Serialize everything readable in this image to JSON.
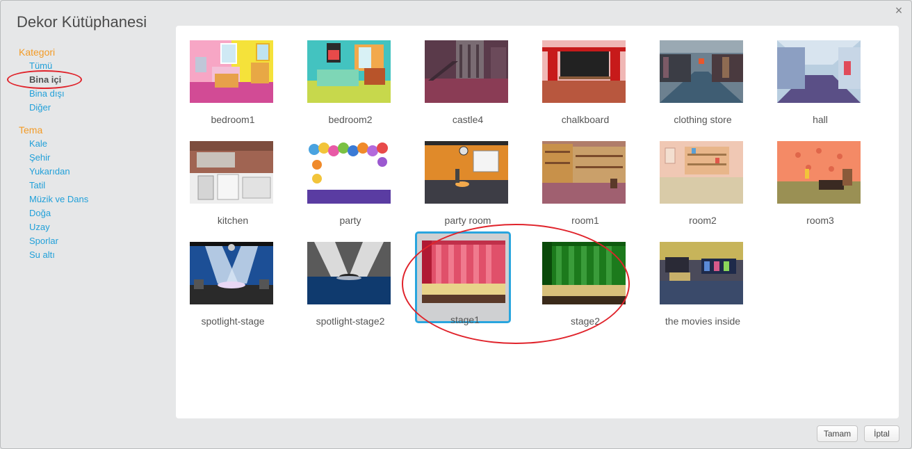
{
  "dialog": {
    "title": "Dekor Kütüphanesi",
    "close_glyph": "×"
  },
  "sidebar": {
    "category_heading": "Kategori",
    "categories": [
      "Tümü",
      "Bina içi",
      "Bina dışı",
      "Diğer"
    ],
    "selected_category": "Bina içi",
    "theme_heading": "Tema",
    "themes": [
      "Kale",
      "Şehir",
      "Yukarıdan",
      "Tatil",
      "Müzik ve Dans",
      "Doğa",
      "Uzay",
      "Sporlar",
      "Su altı"
    ]
  },
  "backdrops": [
    {
      "name": "bedroom1",
      "icon": "bedroom1-thumbnail"
    },
    {
      "name": "bedroom2",
      "icon": "bedroom2-thumbnail"
    },
    {
      "name": "castle4",
      "icon": "castle4-thumbnail"
    },
    {
      "name": "chalkboard",
      "icon": "chalkboard-thumbnail"
    },
    {
      "name": "clothing store",
      "icon": "clothing-store-thumbnail"
    },
    {
      "name": "hall",
      "icon": "hall-thumbnail"
    },
    {
      "name": "kitchen",
      "icon": "kitchen-thumbnail"
    },
    {
      "name": "party",
      "icon": "party-thumbnail"
    },
    {
      "name": "party room",
      "icon": "party-room-thumbnail"
    },
    {
      "name": "room1",
      "icon": "room1-thumbnail"
    },
    {
      "name": "room2",
      "icon": "room2-thumbnail"
    },
    {
      "name": "room3",
      "icon": "room3-thumbnail"
    },
    {
      "name": "spotlight-stage",
      "icon": "spotlight-stage-thumbnail"
    },
    {
      "name": "spotlight-stage2",
      "icon": "spotlight-stage2-thumbnail"
    },
    {
      "name": "stage1",
      "icon": "stage1-thumbnail"
    },
    {
      "name": "stage2",
      "icon": "stage2-thumbnail"
    },
    {
      "name": "the movies inside",
      "icon": "the-movies-inside-thumbnail"
    }
  ],
  "selected_backdrop": "stage1",
  "buttons": {
    "ok_label": "Tamam",
    "cancel_label": "İptal"
  },
  "colors": {
    "accent": "#29a5de",
    "heading": "#f39b26",
    "link": "#21a0d9",
    "annotation": "#e0232b"
  }
}
